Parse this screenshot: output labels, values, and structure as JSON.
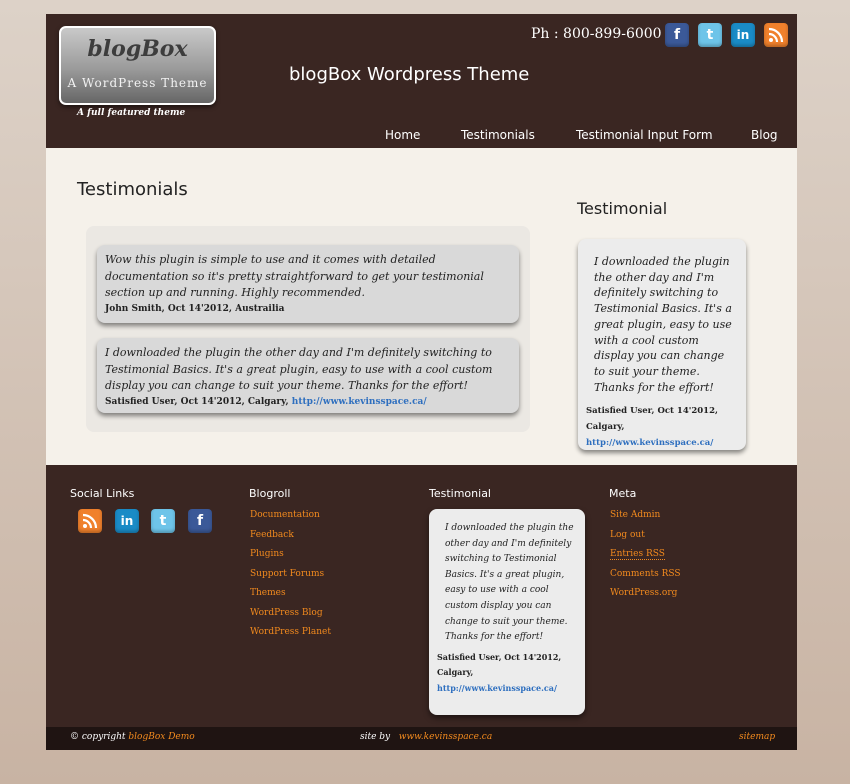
{
  "header": {
    "logo_title": "blogBox",
    "logo_subtitle": "A WordPress Theme",
    "tagline": "A full featured theme",
    "site_title": "blogBox Wordpress Theme",
    "phone": "Ph : 800-899-6000",
    "social_icons": [
      "facebook-icon",
      "twitter-icon",
      "linkedin-icon",
      "rss-icon"
    ]
  },
  "nav": {
    "items": [
      {
        "label": "Home"
      },
      {
        "label": "Testimonials"
      },
      {
        "label": "Testimonial Input Form"
      },
      {
        "label": "Blog"
      }
    ]
  },
  "main": {
    "heading": "Testimonials",
    "testimonials": [
      {
        "text": "Wow this plugin is simple to use and it comes with detailed documentation so it's pretty straightforward to get your testimonial section up and running. Highly recommended.",
        "author": "John Smith, Oct 14'2012, Austrailia"
      },
      {
        "text": "I downloaded the plugin the other day and I'm definitely switching to Testimonial Basics. It's a great plugin, easy to use with a cool custom display you can change to suit your theme. Thanks for the effort!",
        "author": "Satisfied User, Oct 14'2012, Calgary,",
        "link": "http://www.kevinsspace.ca/"
      }
    ]
  },
  "sidebar": {
    "heading": "Testimonial",
    "text": "I downloaded the plugin the other day and I'm definitely switching to Testimonial Basics. It's a great plugin, easy to use with a cool custom display you can change to suit your theme. Thanks for the effort!",
    "author": "Satisfied User, Oct 14'2012, Calgary,",
    "link": "http://www.kevinsspace.ca/"
  },
  "footer": {
    "social_title": "Social Links",
    "blogroll_title": "Blogroll",
    "blogroll": [
      "Documentation",
      "Feedback",
      "Plugins",
      "Support Forums",
      "Themes",
      "WordPress Blog",
      "WordPress Planet"
    ],
    "testimonial_title": "Testimonial",
    "testimonial_text": "I downloaded the plugin the other day and I'm definitely switching to Testimonial Basics. It's a great plugin, easy to use with a cool custom display you can change to suit your theme. Thanks for the effort!",
    "testimonial_author": "Satisfied User, Oct 14'2012, Calgary,",
    "testimonial_link": "http://www.kevinsspace.ca/",
    "meta_title": "Meta",
    "meta": [
      "Site Admin",
      "Log out",
      "Entries RSS",
      "Comments RSS",
      "WordPress.org"
    ]
  },
  "bottom": {
    "copyright": "© copyright",
    "copyright_link": "blogBox Demo",
    "siteby": "site by",
    "siteby_link": "www.kevinsspace.ca",
    "sitemap": "sitemap"
  },
  "colors": {
    "header_bg": "#3a2622",
    "body_bg": "#f5f1ea",
    "link_orange": "#f28a1e",
    "link_blue": "#2e6fbf"
  }
}
